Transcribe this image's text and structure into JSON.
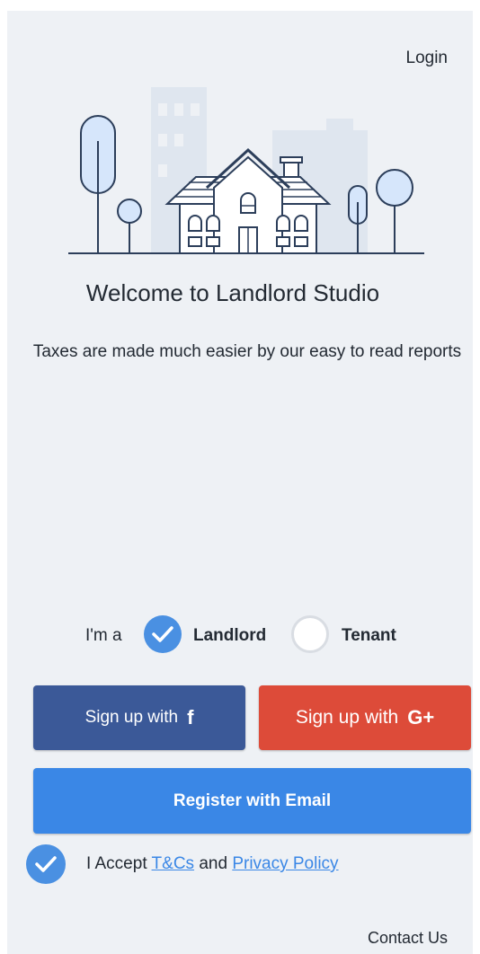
{
  "header": {
    "login_label": "Login"
  },
  "welcome": {
    "title": "Welcome to Landlord Studio",
    "subtitle": "Taxes are made much easier by our easy to read reports"
  },
  "role_selector": {
    "prefix": "I'm a",
    "options": [
      {
        "label": "Landlord",
        "selected": true
      },
      {
        "label": "Tenant",
        "selected": false
      }
    ]
  },
  "signup": {
    "facebook_label": "Sign up with",
    "facebook_glyph": "f",
    "google_label": "Sign up with",
    "google_glyph": "G+",
    "email_label": "Register with Email"
  },
  "terms": {
    "accepted": true,
    "prefix": "I Accept",
    "tcs_link": "T&Cs",
    "joiner": "and",
    "privacy_link": "Privacy Policy"
  },
  "footer": {
    "contact_label": "Contact Us"
  },
  "colors": {
    "background": "#eef1f5",
    "facebook": "#3b5998",
    "google": "#dd4b39",
    "primary": "#3a87e6",
    "check": "#4a90e2",
    "text": "#232a33"
  },
  "icons": {
    "hero": "house-illustration",
    "check": "checkmark-icon"
  }
}
